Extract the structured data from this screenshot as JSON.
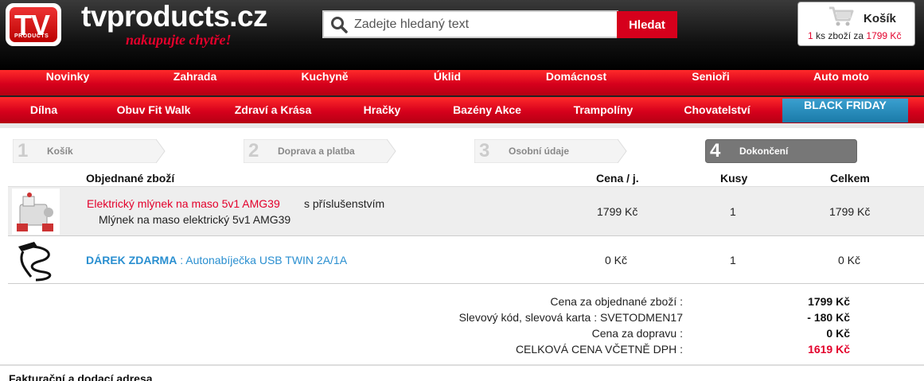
{
  "header": {
    "logo_text": "TV",
    "logo_sub": "PRODUCTS",
    "site_name": "tvproducts.cz",
    "slogan": "nakupujte chytře!",
    "search": {
      "placeholder": "Zadejte hledaný text",
      "button": "Hledat",
      "icon": "search-icon"
    },
    "cart": {
      "title": "Košík",
      "count": "1",
      "summary_mid": "ks zboží za",
      "summary_total": "1799 Kč",
      "icon": "cart-icon"
    }
  },
  "nav_primary": [
    "Novinky",
    "Zahrada",
    "Kuchyně",
    "Úklid",
    "Domácnost",
    "Senioři",
    "Auto moto"
  ],
  "nav_secondary": [
    "Dílna",
    "Obuv Fit Walk",
    "Zdraví a Krása",
    "Hračky",
    "Bazény Akce",
    "Trampolíny",
    "Chovatelství"
  ],
  "nav_highlight": "BLACK FRIDAY",
  "steps": [
    {
      "num": "1",
      "label": "Košík",
      "active": false
    },
    {
      "num": "2",
      "label": "Doprava a platba",
      "active": false
    },
    {
      "num": "3",
      "label": "Osobní údaje",
      "active": false
    },
    {
      "num": "4",
      "label": "Dokončení",
      "active": true
    }
  ],
  "table": {
    "headers": {
      "item": "Objednané zboží",
      "price": "Cena / j.",
      "qty": "Kusy",
      "total": "Celkem"
    },
    "rows": [
      {
        "title": "Elektrický mlýnek na maso 5v1 AMG39",
        "suffix": "s příslušenstvím",
        "subtitle": "Mlýnek na maso elektrický 5v1 AMG39",
        "price": "1799 Kč",
        "qty": "1",
        "total": "1799 Kč"
      },
      {
        "prefix": "DÁREK ZDARMA",
        "title": " : Autonabíječka USB TWIN 2A/1A",
        "price": "0 Kč",
        "qty": "1",
        "total": "0 Kč"
      }
    ]
  },
  "summary": {
    "items_label": "Cena za objednané zboží :",
    "items_value": "1799 Kč",
    "discount_label": "Slevový kód, slevová karta : SVETODMEN17",
    "discount_value": "- 180 Kč",
    "shipping_label": "Cena za dopravu :",
    "shipping_value": "0 Kč",
    "total_label": "CELKOVÁ CENA VČETNĚ DPH :",
    "total_value": "1619 Kč"
  },
  "billing_heading": "Fakturační a dodací adresa",
  "colors": {
    "brand_red": "#d6001c",
    "link_blue": "#2a8fd0",
    "highlight_blue": "#1a7aa8"
  }
}
